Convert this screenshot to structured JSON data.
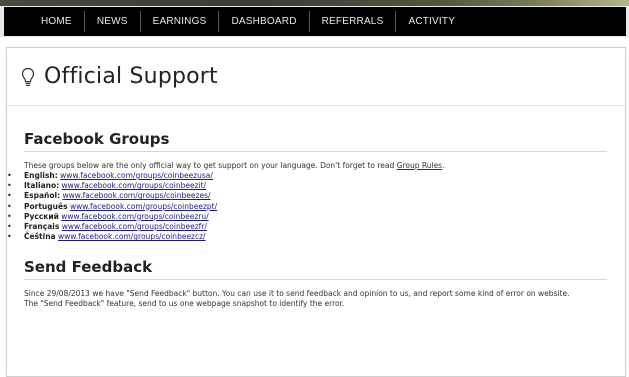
{
  "nav": {
    "items": [
      "HOME",
      "NEWS",
      "EARNINGS",
      "DASHBOARD",
      "REFERRALS",
      "ACTIVITY"
    ]
  },
  "page": {
    "title": "Official Support"
  },
  "facebook": {
    "heading": "Facebook Groups",
    "intro": "These groups below are the only official way to get support on your language. Don't forget to read ",
    "rules_link": "Group Rules",
    "intro_end": ".",
    "groups": [
      {
        "lang": "English:",
        "url": "www.facebook.com/groups/coinbeezusa/"
      },
      {
        "lang": "Italiano:",
        "url": "www.facebook.com/groups/coinbeezit/"
      },
      {
        "lang": "Español:",
        "url": "www.facebook.com/groups/coinbeezes/"
      },
      {
        "lang": "Português",
        "url": "www.facebook.com/groups/coinbeezpt/"
      },
      {
        "lang": "Русский",
        "url": "www.facebook.com/groups/coinbeezru/"
      },
      {
        "lang": "Français",
        "url": "www.facebook.com/groups/coinbeezfr/"
      },
      {
        "lang": "Čeština",
        "url": "www.facebook.com/groups/coinbeezcz/"
      }
    ]
  },
  "feedback": {
    "heading": "Send Feedback",
    "text1": "Since 29/08/2013 we have \"Send Feedback\" button. You can use it to send feedback and opinion to us, and report some kind of error on website.",
    "text2": "The \"Send Feedback\" feature, send to us one webpage snapshot to identify the error."
  }
}
